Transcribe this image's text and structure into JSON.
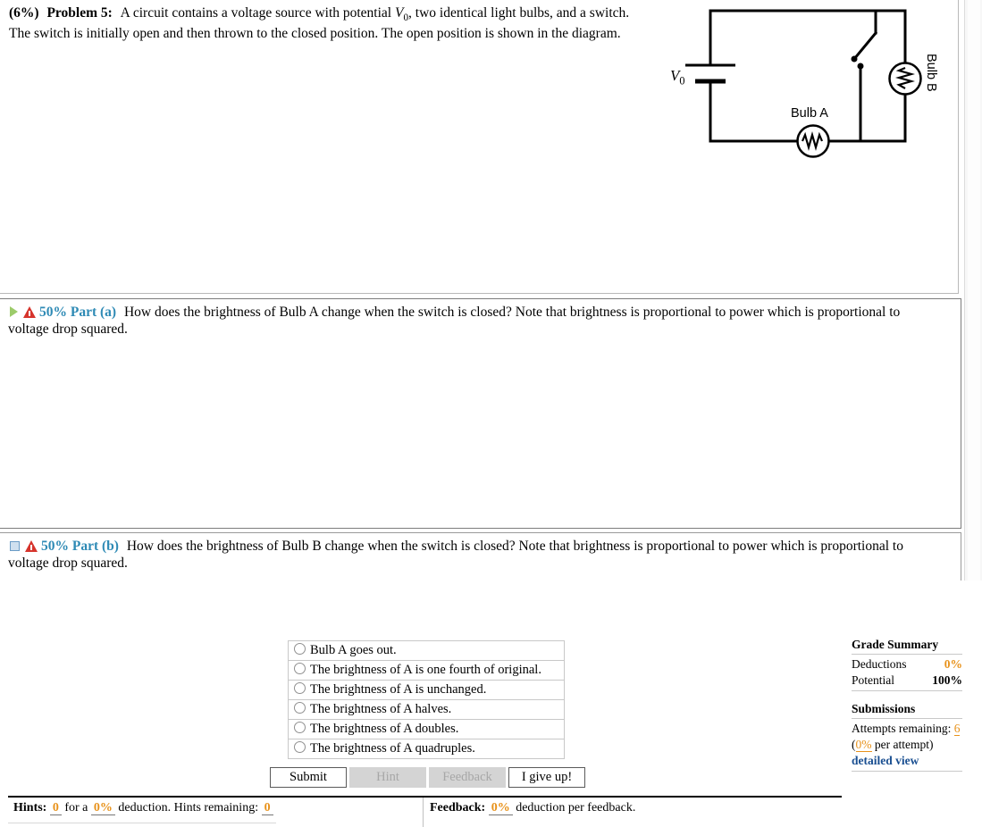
{
  "problem": {
    "weight": "(6%)",
    "label": "Problem 5:",
    "statement_part1": "A circuit contains a voltage source with potential ",
    "variable": "V",
    "variable_sub": "0",
    "statement_part2": ", two identical light bulbs, and a switch. The switch is initially open and then thrown to the closed position. The open position is shown in the diagram."
  },
  "circuit": {
    "source_label": "V",
    "source_label_sub": "0",
    "bulb_a_label": "Bulb A",
    "bulb_b_label": "Bulb B"
  },
  "part_a": {
    "toggle_icon": "triangle-right-icon",
    "warning_icon": "warning-triangle-icon",
    "percent": "50%",
    "title": "Part (a)",
    "text_line1": "How does the brightness of Bulb A change when the switch is closed? Note that brightness is proportional to power which is proportional to",
    "text_line2": "voltage drop squared.",
    "choices": [
      "Bulb A goes out.",
      "The brightness of A is one fourth of original.",
      "The brightness of A is unchanged.",
      "The brightness of A halves.",
      "The brightness of A doubles.",
      "The brightness of A quadruples."
    ],
    "buttons": [
      {
        "label": "Submit",
        "enabled": true
      },
      {
        "label": "Hint",
        "enabled": false
      },
      {
        "label": "Feedback",
        "enabled": false
      },
      {
        "label": "I give up!",
        "enabled": true
      }
    ]
  },
  "grade_summary": {
    "title": "Grade Summary",
    "rows": [
      {
        "label": "Deductions",
        "value": "0%"
      },
      {
        "label": "Potential",
        "value": "100%"
      }
    ],
    "submissions_title": "Submissions",
    "attempts_label": "Attempts remaining:",
    "attempts_value": "6",
    "per_attempt_open": "(",
    "per_attempt_value": "0%",
    "per_attempt_rest": " per attempt)",
    "detailed_view": "detailed view"
  },
  "hints_bar": {
    "hints_label": "Hints:",
    "hints_count": "0",
    "for_a": "for a",
    "hints_deduction": "0%",
    "deduction_text": "deduction. Hints remaining:",
    "hints_remaining": "0"
  },
  "feedback_bar": {
    "feedback_label": "Feedback:",
    "feedback_deduction": "0%",
    "feedback_text": "deduction per feedback."
  },
  "part_b": {
    "toggle_icon": "square-collapsed-icon",
    "warning_icon": "warning-triangle-icon",
    "percent": "50%",
    "title": "Part (b)",
    "text_line1": "How does the brightness of Bulb B change when the switch is closed? Note that brightness is proportional to power which is proportional to",
    "text_line2": "voltage drop squared."
  },
  "colors": {
    "accent_blue": "#2e8ab5",
    "orange": "#e8921b",
    "link_blue": "#1a4f91",
    "warning_red": "#d6342c",
    "toggle_green": "#9ccb6a"
  }
}
